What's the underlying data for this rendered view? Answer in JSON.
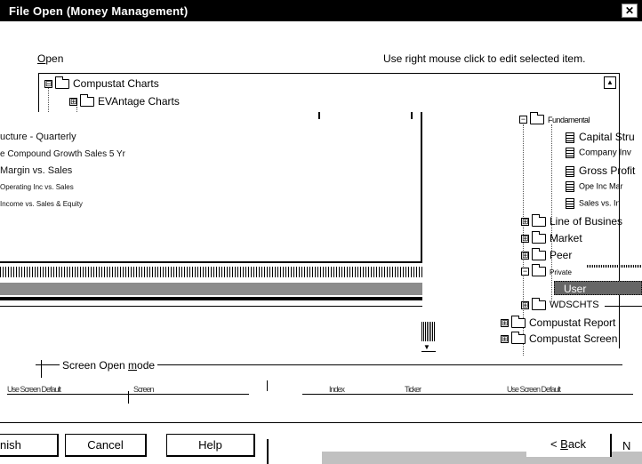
{
  "window": {
    "title": "File Open   (Money Management)",
    "close_glyph": "✕"
  },
  "open_label": {
    "mnemonic": "O",
    "rest": "pen"
  },
  "hint": "Use right mouse click to edit selected item.",
  "tree": {
    "items_top": [
      {
        "label": "Compustat Charts",
        "expander": "⊟"
      },
      {
        "label": "EVAntage Charts",
        "expander": "⊞"
      }
    ],
    "items_right": [
      {
        "label": "Capital Stru",
        "kind": "doc"
      },
      {
        "label": "Company Inv",
        "kind": "doc"
      },
      {
        "label": "Gross Profit",
        "kind": "doc"
      },
      {
        "label": "Ope Inc Mar",
        "kind": "doc"
      },
      {
        "label": "Sales vs. In",
        "kind": "doc"
      },
      {
        "label": "Line of Busines",
        "kind": "folder",
        "expander": "⊞"
      },
      {
        "label": "Market",
        "kind": "folder",
        "expander": "⊞"
      },
      {
        "label": "Peer",
        "kind": "folder",
        "expander": "⊞"
      },
      {
        "label": "User",
        "kind": "selected"
      },
      {
        "label": "WDSCHTS",
        "kind": "folder",
        "expander": "⊞"
      },
      {
        "label": "Compustat Report",
        "kind": "folder",
        "expander": "⊞"
      },
      {
        "label": "Compustat Screen",
        "kind": "folder",
        "expander": "⊞"
      }
    ],
    "fundamental_partial": "Fundamental",
    "private_partial": "Private"
  },
  "overlay_lines": [
    "ucture - Quarterly",
    "e Compound Growth Sales 5 Yr",
    "Margin vs. Sales",
    "Operating Inc vs. Sales",
    "Income vs. Sales & Equity"
  ],
  "screen_open": {
    "legend_prefix": "Screen Open ",
    "legend_mnemonic": "m",
    "legend_suffix": "ode",
    "garbled": [
      "Use Screen Default",
      "Screen",
      "Index",
      "Ticker",
      "Use Screen Default"
    ]
  },
  "buttons": {
    "finish_partial": "nish",
    "cancel": "Cancel",
    "help": "Help",
    "back_prefix": "< ",
    "back_mnemonic": "B",
    "back_suffix": "ack",
    "next_partial": "N"
  }
}
